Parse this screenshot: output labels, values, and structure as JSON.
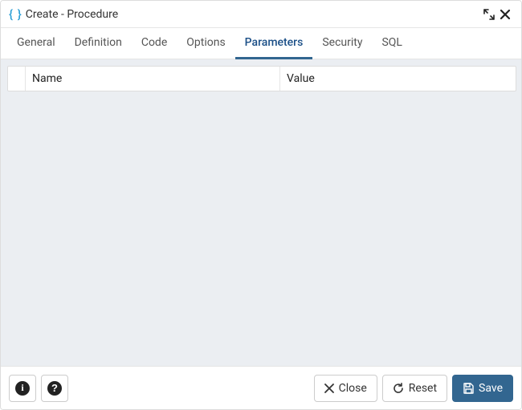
{
  "title": "Create - Procedure",
  "tabs": [
    "General",
    "Definition",
    "Code",
    "Options",
    "Parameters",
    "Security",
    "SQL"
  ],
  "active_tab_index": 4,
  "columns": {
    "name": "Name",
    "value": "Value"
  },
  "rows": [],
  "buttons": {
    "close": "Close",
    "reset": "Reset",
    "save": "Save"
  },
  "colors": {
    "accent": "#326690",
    "content_bg": "#ebeef2",
    "brace": "#2a9fd6"
  }
}
